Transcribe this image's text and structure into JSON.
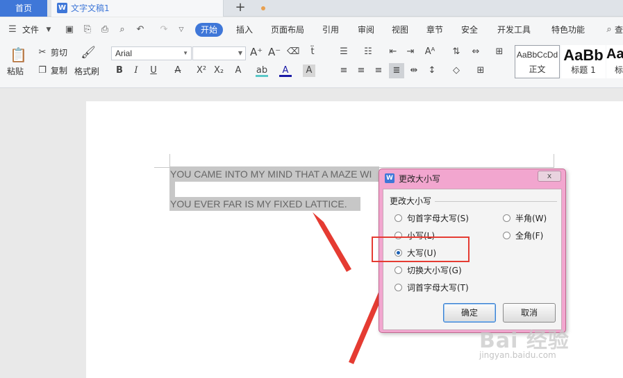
{
  "tabs": {
    "home": "首页",
    "doc_title": "文字文稿1",
    "add": "+"
  },
  "menu": {
    "file": "文件",
    "items": [
      "开始",
      "插入",
      "页面布局",
      "引用",
      "审阅",
      "视图",
      "章节",
      "安全",
      "开发工具",
      "特色功能"
    ],
    "search": "查"
  },
  "ribbon": {
    "paste": "粘贴",
    "cut": "剪切",
    "copy": "复制",
    "format_painter": "格式刷",
    "font_name": "Arial",
    "font_size": "",
    "styles": [
      {
        "sample": "AaBbCcDd",
        "label": "正文"
      },
      {
        "sample": "AaBb",
        "label": "标题 1"
      },
      {
        "sample": "Aa",
        "label": "标"
      }
    ]
  },
  "document": {
    "line1": "YOU CAME INTO MY MIND THAT A MAZE WI",
    "line2": "YOU EVER FAR IS MY FIXED LATTICE."
  },
  "dialog": {
    "title": "更改大小写",
    "close": "x",
    "group": "更改大小写",
    "options": [
      {
        "label": "句首字母大写(S)",
        "checked": false
      },
      {
        "label": "小写(L)",
        "checked": false
      },
      {
        "label": "大写(U)",
        "checked": true
      },
      {
        "label": "切换大小写(G)",
        "checked": false
      },
      {
        "label": "词首字母大写(T)",
        "checked": false
      }
    ],
    "options_right": [
      {
        "label": "半角(W)",
        "checked": false
      },
      {
        "label": "全角(F)",
        "checked": false
      }
    ],
    "ok": "确定",
    "cancel": "取消"
  },
  "watermark": {
    "brand": "Bai 经验",
    "url": "jingyan.baidu.com"
  },
  "colors": {
    "accent": "#3f77d8",
    "dialog_frame": "#f2a6cf",
    "annotation": "#e53b32"
  }
}
